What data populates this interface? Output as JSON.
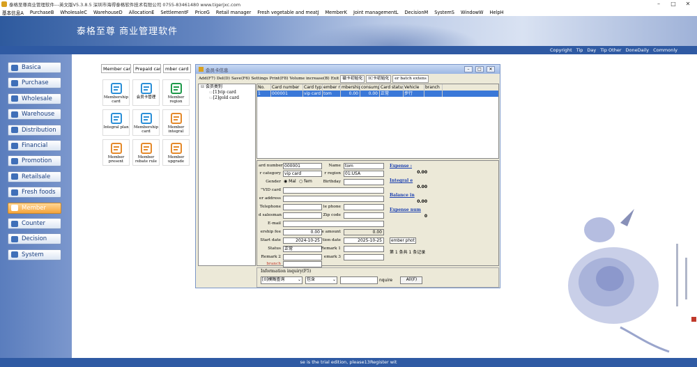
{
  "window": {
    "title": "泰格至尊商业管理软件---英文版V5.3.8.5   深圳市海得泰格软件技术有限公司   0755-83461480   www.tigerjxc.com",
    "controls": [
      "–",
      "□",
      "✕"
    ]
  },
  "menubar": [
    "基本信息A",
    "PurchaseB",
    "WholesaleC",
    "WarehouseD",
    "AllocationE",
    "SettlementF",
    "PriceG",
    "Retail manager",
    "Fresh vegetable and meatJ",
    "MemberK",
    "Joint managementL",
    "DecisionM",
    "SystemS",
    "WindowW",
    "HelpH"
  ],
  "banner": {
    "title": "泰格至尊  商业管理软件"
  },
  "quickbar": [
    "Copyright",
    "Tip",
    "Day",
    "Tip Other",
    "DoneDaily",
    "Commonly"
  ],
  "sidebar": [
    {
      "label": "Basica",
      "active": false
    },
    {
      "label": "Purchase",
      "active": false
    },
    {
      "label": "Wholesale",
      "active": false
    },
    {
      "label": "Warehouse",
      "active": false
    },
    {
      "label": "Distribution",
      "active": false
    },
    {
      "label": "Financial",
      "active": false
    },
    {
      "label": "Promotion",
      "active": false
    },
    {
      "label": "Retailsale",
      "active": false
    },
    {
      "label": "Fresh foods",
      "active": false
    },
    {
      "label": "Member",
      "active": true
    },
    {
      "label": "Counter",
      "active": false
    },
    {
      "label": "Decision",
      "active": false
    },
    {
      "label": "System",
      "active": false
    }
  ],
  "tabs": [
    "Member card",
    "Prepaid card",
    "mber card re"
  ],
  "tiles": [
    {
      "label": "Membership card",
      "icon": "refresh-card-icon",
      "color": "#2a8fd8"
    },
    {
      "label": "会员卡管理",
      "icon": "chart-card-icon",
      "color": "#2a8fd8"
    },
    {
      "label": "Member region",
      "icon": "globe-icon",
      "color": "#1e9a4a"
    },
    {
      "label": "Integral plan",
      "icon": "card-icon",
      "color": "#2a8fd8"
    },
    {
      "label": "Membership card",
      "icon": "clipboard-icon",
      "color": "#2a8fd8"
    },
    {
      "label": "Member integral",
      "icon": "list-icon",
      "color": "#e5892a"
    },
    {
      "label": "Member present",
      "icon": "gift-icon",
      "color": "#e5892a"
    },
    {
      "label": "Member rebate rule",
      "icon": "document-icon",
      "color": "#e5892a"
    },
    {
      "label": "Member upgrade",
      "icon": "upgrade-icon",
      "color": "#e5892a"
    }
  ],
  "dialog": {
    "title": "会员卡信息",
    "toolbar": [
      "Add(F7)",
      "Del(D)",
      "Save(F6)",
      "Settings",
      "Print(F8)",
      "Volume increase(B)",
      "Exit",
      "磁卡初始化",
      "IC卡初始化",
      "er batch extens"
    ],
    "tree": {
      "root": "会员类别",
      "children": [
        "[1]vip card",
        "[2]gold card"
      ]
    },
    "grid": {
      "columns": [
        "No.",
        "Card number",
        "Card type",
        "ember nam",
        "mbership fe",
        "consumptio",
        "Card status",
        "Vehicle",
        "branch"
      ],
      "rows": [
        [
          "1",
          "000001",
          "vip card",
          "tom",
          "0.00",
          "0.00",
          "正常",
          "步行",
          ""
        ]
      ]
    },
    "form": {
      "card_number_label": "ard number",
      "card_number": "000001",
      "name_label": "Name",
      "name": "tom",
      "category_label": "r category",
      "category": "vip card",
      "region_label": "r region",
      "region": "01:USA",
      "gender_label": "Gender",
      "gender_male": "Mal",
      "gender_female": "fem",
      "birthday_label": "Birthday",
      "vid_label": "\"VID card",
      "address_label": "er address",
      "telephone_label": "Telephone",
      "phone_label": "le phone",
      "salesman_label": "d salesman",
      "zip_label": "Zip code",
      "email_label": "E-mail",
      "fee_label": "ership fee",
      "fee": "0.00",
      "amount_label": "e amount",
      "amount": "0.00",
      "start_label": "Start date",
      "start": "2024-10-25",
      "expire_label": "tion date",
      "expire": "2025-10-25",
      "status_label": "Status",
      "status": "正常",
      "remark1_label": "Remark 1",
      "remark2_label": "Remark 2",
      "remark3_label": "emark 3",
      "branch_label": "branch"
    },
    "summary": [
      {
        "label": "Expense :",
        "value": "0.00"
      },
      {
        "label": "Integral e",
        "value": "0.00"
      },
      {
        "label": "Balance in",
        "value": "0.00"
      },
      {
        "label": "Expense num",
        "value": "0"
      }
    ],
    "photo_button": "ember phot",
    "record_text": "第 1 条共 1 条记录",
    "inquiry": {
      "label": "Information inquiry(F5)",
      "field": "[0]模糊查询",
      "op": "包含",
      "hint": "nquire",
      "all_button": "All(F)"
    }
  },
  "statusbar": "se is the trial edition, please13Register wit"
}
